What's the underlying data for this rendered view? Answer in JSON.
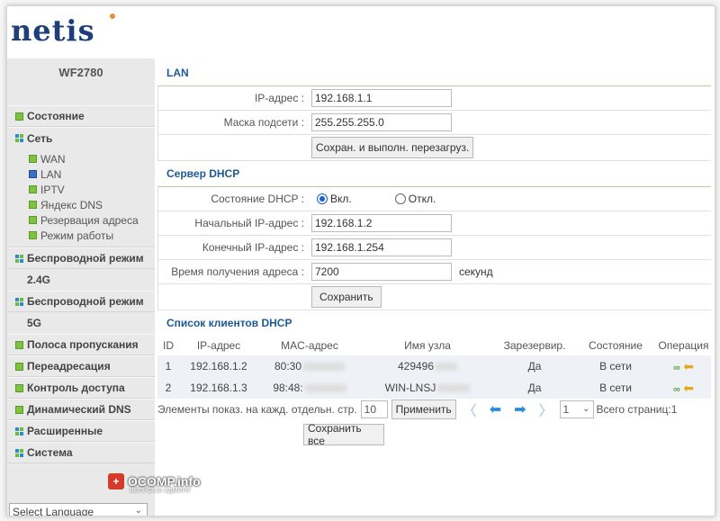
{
  "brand": "netis",
  "model": "WF2780",
  "sidebar": {
    "status": "Состояние",
    "network": "Сеть",
    "network_items": [
      {
        "label": "WAN",
        "active": false
      },
      {
        "label": "LAN",
        "active": true
      },
      {
        "label": "IPTV",
        "active": false
      },
      {
        "label": "Яндекс DNS",
        "active": false
      },
      {
        "label": "Резервация адреса",
        "active": false
      },
      {
        "label": "Режим работы",
        "active": false
      }
    ],
    "wireless1": "Беспроводной режим",
    "band1": "2.4G",
    "wireless2": "Беспроводной режим",
    "band2": "5G",
    "bandwidth": "Полоса пропускания",
    "forwarding": "Переадресация",
    "access": "Контроль доступа",
    "ddns": "Динамический DNS",
    "advanced": "Расширенные",
    "system": "Система",
    "language": "Select Language"
  },
  "lan": {
    "title": "LAN",
    "ip_label": "IP-адрес :",
    "ip_value": "192.168.1.1",
    "mask_label": "Маска подсети :",
    "mask_value": "255.255.255.0",
    "save_reboot": "Сохран. и выполн. перезагруз."
  },
  "dhcp": {
    "title": "Сервер DHCP",
    "state_label": "Состояние DHCP :",
    "on_label": "Вкл.",
    "off_label": "Откл.",
    "start_label": "Начальный IP-адрес :",
    "start_value": "192.168.1.2",
    "end_label": "Конечный IP-адрес :",
    "end_value": "192.168.1.254",
    "lease_label": "Время получения адреса :",
    "lease_value": "7200",
    "lease_unit": "секунд",
    "save": "Сохранить"
  },
  "clients": {
    "title": "Список клиентов DHCP",
    "headers": [
      "ID",
      "IP-адрес",
      "MAC-адрес",
      "Имя узла",
      "Зарезервир.",
      "Состояние",
      "Операция"
    ],
    "rows": [
      {
        "id": "1",
        "ip": "192.168.1.2",
        "mac": "80:30",
        "host": "429496",
        "reserved": "Да",
        "state": "В сети"
      },
      {
        "id": "2",
        "ip": "192.168.1.3",
        "mac": "98:48:",
        "host": "WIN-LNSJ",
        "reserved": "Да",
        "state": "В сети"
      }
    ],
    "per_page_label": "Элементы показ. на кажд. отдельн. стр.",
    "per_page_value": "10",
    "apply": "Применить",
    "page_value": "1",
    "total_pages": "Всего страниц:1",
    "save_all": "Сохранить все"
  },
  "watermark": {
    "title": "OCOMP.info",
    "subtitle": "ВОПРОСЫ АДМИНУ"
  }
}
